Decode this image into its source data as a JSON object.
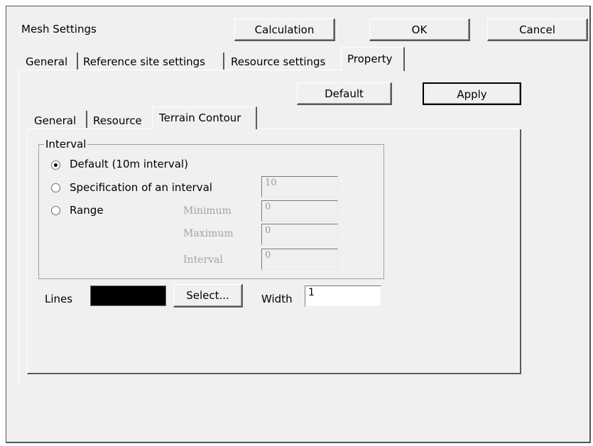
{
  "dialog": {
    "title": "Mesh Settings",
    "buttons": {
      "calculation": "Calculation",
      "ok": "OK",
      "cancel": "Cancel"
    }
  },
  "main_tabs": [
    {
      "label": "General"
    },
    {
      "label": "Reference site settings"
    },
    {
      "label": "Resource settings"
    },
    {
      "label": "Property",
      "active": true
    }
  ],
  "property": {
    "default_button": "Default",
    "apply_button": "Apply",
    "sub_tabs": [
      {
        "label": "General"
      },
      {
        "label": "Resource"
      },
      {
        "label": "Terrain Contour",
        "active": true
      }
    ],
    "interval_group": {
      "title": "Interval",
      "selected": "default",
      "options": {
        "default": "Default (10m interval)",
        "specification": "Specification of an interval",
        "range": "Range"
      },
      "specification_value": "10",
      "range": {
        "minimum_label": "Minimum",
        "minimum_value": "0",
        "maximum_label": "Maximum",
        "maximum_value": "0",
        "interval_label": "Interval",
        "interval_value": "0"
      }
    },
    "lines": {
      "label": "Lines",
      "color": "#000000",
      "select_button": "Select...",
      "width_label": "Width",
      "width_value": "1"
    }
  }
}
